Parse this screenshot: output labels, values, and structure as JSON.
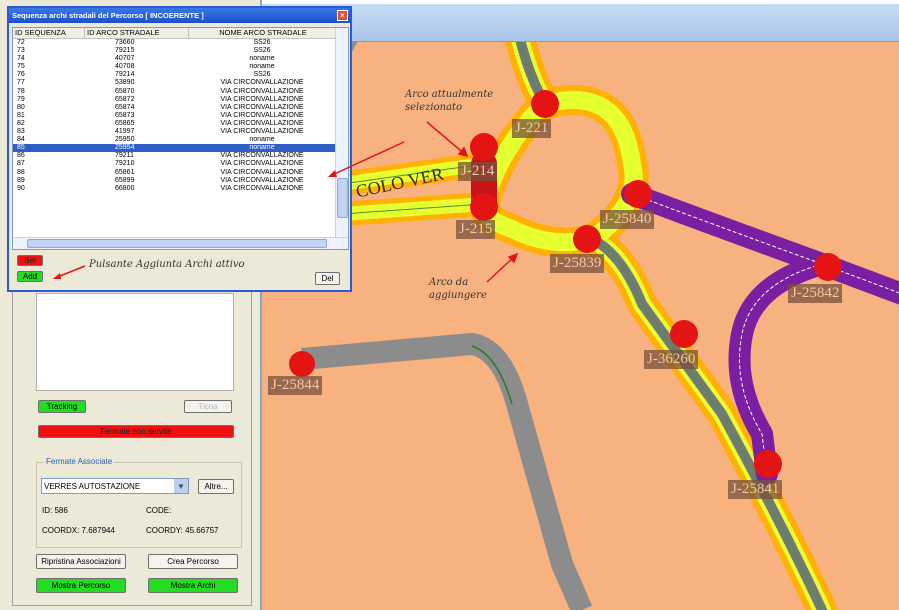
{
  "dialog": {
    "title": "Sequenza archi stradali del Percorso  [ INCOERENTE ]",
    "close_glyph": "×",
    "columns": [
      "ID SEQUENZA",
      "ID ARCO STRADALE",
      "NOME ARCO STRADALE"
    ],
    "rows": [
      [
        "72",
        "73660",
        "SS26"
      ],
      [
        "73",
        "79215",
        "SS26"
      ],
      [
        "74",
        "40707",
        "noname"
      ],
      [
        "75",
        "40708",
        "noname"
      ],
      [
        "76",
        "79214",
        "SS26"
      ],
      [
        "77",
        "53890",
        "VIA CIRCONVALLAZIONE"
      ],
      [
        "78",
        "65870",
        "VIA CIRCONVALLAZIONE"
      ],
      [
        "79",
        "65872",
        "VIA CIRCONVALLAZIONE"
      ],
      [
        "80",
        "65874",
        "VIA CIRCONVALLAZIONE"
      ],
      [
        "81",
        "65873",
        "VIA CIRCONVALLAZIONE"
      ],
      [
        "82",
        "65865",
        "VIA CIRCONVALLAZIONE"
      ],
      [
        "83",
        "41997",
        "VIA CIRCONVALLAZIONE"
      ],
      [
        "84",
        "25950",
        "noname"
      ],
      [
        "85",
        "25954",
        "noname"
      ],
      [
        "86",
        "79211",
        "VIA CIRCONVALLAZIONE"
      ],
      [
        "87",
        "79210",
        "VIA CIRCONVALLAZIONE"
      ],
      [
        "88",
        "65861",
        "VIA CIRCONVALLAZIONE"
      ],
      [
        "89",
        "65899",
        "VIA CIRCONVALLAZIONE"
      ],
      [
        "90",
        "66800",
        "VIA CIRCONVALLAZIONE"
      ]
    ],
    "selected_row_index": 13,
    "sel_label": "Sel",
    "add_label": "Add",
    "del_label": "Del",
    "add_annotation": "Pulsante Aggiunta Archi attivo"
  },
  "map": {
    "annotation_selected": "Arco attualmente selezionato",
    "annotation_add": "Arco da aggiungere",
    "road_name": "COLO VER",
    "junctions": [
      "J-221",
      "J-214",
      "J-215",
      "J-25840",
      "J-25839",
      "J-25842",
      "J-36260",
      "J-25844",
      "J-25841"
    ]
  },
  "panel": {
    "tracking_label": "Tracking",
    "ticna_label": "Ticna",
    "fermate_label": "Fermate non servite",
    "fermate_group_label": "Fermate Associate",
    "fermata_selected": "VERRES AUTOSTAZIONE",
    "altre_label": "Altre...",
    "id_label": "ID: 586",
    "code_label": "CODE:",
    "coordx_label": "COORDX: 7.687944",
    "coordy_label": "COORDY: 45.66757",
    "ripristina_label": "Ripristina Associazioni",
    "crea_label": "Crea Percorso",
    "mostra_percorso_label": "Mostra Percorso",
    "mostra_archi_label": "Mostra Archi"
  },
  "colors": {
    "map_bg": "#f8b27f",
    "selected_route": "#e6ff30",
    "halo": "#ffb000",
    "purple_route": "#7b1fa2",
    "gray_road": "#8c8c8c",
    "junction": "#e51414",
    "selection_blue": "#2f5ec9",
    "button_green": "#22dd22",
    "button_red": "#ee1111"
  }
}
